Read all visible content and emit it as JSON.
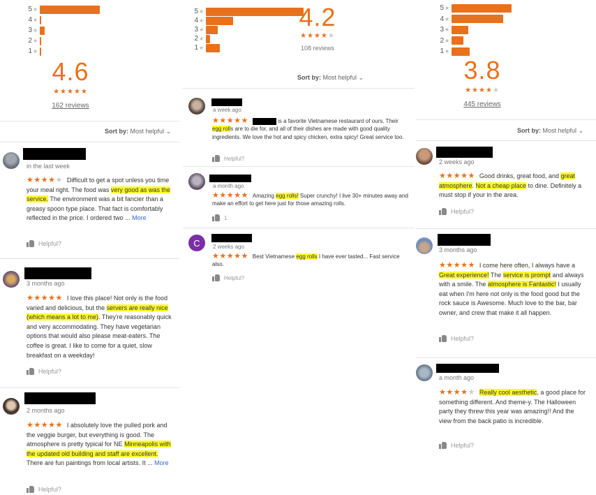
{
  "panels": [
    {
      "id": "p1",
      "histogram": [
        {
          "label": "5",
          "fraction": 1.0
        },
        {
          "label": "4",
          "fraction": 0.0
        },
        {
          "label": "3",
          "fraction": 0.08
        },
        {
          "label": "2",
          "fraction": 0.02
        },
        {
          "label": "1",
          "fraction": 0.02
        }
      ],
      "score": "4.6",
      "score_stars": 4.5,
      "reviews_link": "162 reviews",
      "sort_label": "Sort by:",
      "sort_value": "Most helpful",
      "reviews": [
        {
          "when": "in the last week",
          "stars": 4,
          "segments": [
            {
              "t": "Difficult to get a spot unless you time your meal right.  The food was "
            },
            {
              "t": "very good as was the service.",
              "hl": true
            },
            {
              "t": "  The environment was a bit fancier than a greasy spoon type place.  That fact is comfortably reflected in the price.  I ordered two ... "
            },
            {
              "t": "More",
              "more": true
            }
          ],
          "helpful": "Helpful?"
        },
        {
          "when": "3 months ago",
          "stars": 5,
          "segments": [
            {
              "t": "I love this place! Not only is the food varied and delicious, but the "
            },
            {
              "t": "servers are really nice (which means a lot to me)",
              "hl": true
            },
            {
              "t": ". They're reasonably quick and very accommodating. They have vegetarian options that would also please meat-eaters. The coffee is great. I like to come for a quiet, slow breakfast on a weekday!"
            }
          ],
          "helpful": "Helpful?"
        },
        {
          "when": "2 months ago",
          "stars": 5,
          "segments": [
            {
              "t": "I absolutely love the pulled pork and the veggie burger, but everything is good. The atmosphere is pretty typical for NE "
            },
            {
              "t": "Minneapolis with the updated old building and staff are excellent.",
              "hl": true
            },
            {
              "t": " There are fun paintings from local artists. It ... "
            },
            {
              "t": "More",
              "more": true
            }
          ],
          "helpful": "Helpful?"
        }
      ]
    },
    {
      "id": "p2",
      "histogram": [
        {
          "label": "5",
          "fraction": 1.0
        },
        {
          "label": "4",
          "fraction": 0.28
        },
        {
          "label": "3",
          "fraction": 0.12
        },
        {
          "label": "2",
          "fraction": 0.04
        },
        {
          "label": "1",
          "fraction": 0.14
        }
      ],
      "score": "4.2",
      "score_stars": 4,
      "reviews_link": "108 reviews",
      "sort_label": "Sort by:",
      "sort_value": "Most helpful",
      "reviews": [
        {
          "when": "a week ago",
          "stars": 5,
          "segments": [
            {
              "t": "[REDACTED]",
              "redact": true
            },
            {
              "t": " is a favorite Vietnamese restaurant of ours.  Their "
            },
            {
              "t": "egg roll",
              "hl": true
            },
            {
              "t": "s are to die for, and all of their dishes are made with good quality ingredients.  We love the hot and spicy chicken, extra spicy!  Great service too."
            }
          ],
          "helpful": "Helpful?"
        },
        {
          "when": "a month ago",
          "stars": 5,
          "segments": [
            {
              "t": "Amazing "
            },
            {
              "t": "egg rolls!",
              "hl": true
            },
            {
              "t": " Super crunchy! I live 30+ minutes away and make an effort to get here just for those amazing rolls."
            }
          ],
          "helpful": "1"
        },
        {
          "avatar_letter": "C",
          "when": "2 weeks ago",
          "stars": 5,
          "segments": [
            {
              "t": "Best Vietnamese "
            },
            {
              "t": "egg rolls",
              "hl": true
            },
            {
              "t": " I have ever tasted... Fast service also."
            }
          ],
          "helpful": "Helpful?"
        }
      ]
    },
    {
      "id": "p3",
      "histogram": [
        {
          "label": "5",
          "fraction": 1.0
        },
        {
          "label": "4",
          "fraction": 0.86
        },
        {
          "label": "3",
          "fraction": 0.28
        },
        {
          "label": "2",
          "fraction": 0.2
        },
        {
          "label": "1",
          "fraction": 0.3
        }
      ],
      "score": "3.8",
      "score_stars": 4,
      "reviews_link": "445 reviews",
      "sort_label": "Sort by:",
      "sort_value": "Most helpful",
      "reviews": [
        {
          "when": "2 weeks ago",
          "stars": 5,
          "segments": [
            {
              "t": "Good drinks, great food, and "
            },
            {
              "t": "great atmosphere",
              "hl": true
            },
            {
              "t": ". "
            },
            {
              "t": "Not a cheap place",
              "hl": true
            },
            {
              "t": " to dine. Definitely a must stop if your in the area."
            }
          ],
          "helpful": "Helpful?"
        },
        {
          "when": "3 months ago",
          "stars": 5,
          "segments": [
            {
              "t": "I come here often, I always have a "
            },
            {
              "t": "Great experience!",
              "hl": true
            },
            {
              "t": " The "
            },
            {
              "t": "service is prompt",
              "hl": true
            },
            {
              "t": " and always with a smile. The "
            },
            {
              "t": "atmosphere is Fantastic!",
              "hl": true
            },
            {
              "t": " I usually eat when I'm here not only is the food good but the rock sauce is Awesome. Much love to the bar, bar owner, and crew that make it all happen."
            }
          ],
          "helpful": "Helpful?"
        },
        {
          "when": "a month ago",
          "stars": 4,
          "segments": [
            {
              "t": "Really cool aesthetic",
              "hl": true
            },
            {
              "t": ", a good place for something different. And theme-y. The Halloween party they threw this year was amazing!! And the view from the back patio is incredible."
            }
          ],
          "helpful": "Helpful?"
        }
      ]
    }
  ]
}
